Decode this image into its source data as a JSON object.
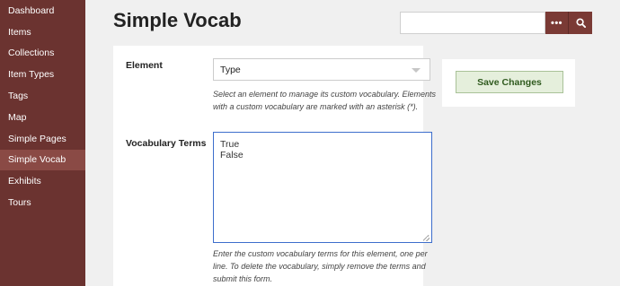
{
  "sidebar": {
    "items": [
      {
        "label": "Dashboard"
      },
      {
        "label": "Items"
      },
      {
        "label": "Collections"
      },
      {
        "label": "Item Types"
      },
      {
        "label": "Tags"
      },
      {
        "label": "Map"
      },
      {
        "label": "Simple Pages"
      },
      {
        "label": "Simple Vocab",
        "active": true
      },
      {
        "label": "Exhibits"
      },
      {
        "label": "Tours"
      }
    ]
  },
  "header": {
    "title": "Simple Vocab",
    "search": {
      "value": "",
      "placeholder": ""
    },
    "more_label": "•••"
  },
  "form": {
    "element_label": "Element",
    "element_selected": "Type",
    "element_help": "Select an element to manage its custom vocabulary. Elements with a custom vocabulary are marked with an asterisk (*).",
    "terms_label": "Vocabulary Terms",
    "terms_value": "True\nFalse",
    "terms_help": "Enter the custom vocabulary terms for this element, one per line. To delete the vocabulary, simply remove the terms and submit this form."
  },
  "actions": {
    "save_label": "Save Changes"
  },
  "colors": {
    "sidebar_bg": "#6b3330",
    "sidebar_active": "#8a4a45",
    "accent": "#7a3a35",
    "save_bg": "#e5efdc",
    "save_text": "#2f5a1e",
    "focus_border": "#3d6ecc"
  }
}
